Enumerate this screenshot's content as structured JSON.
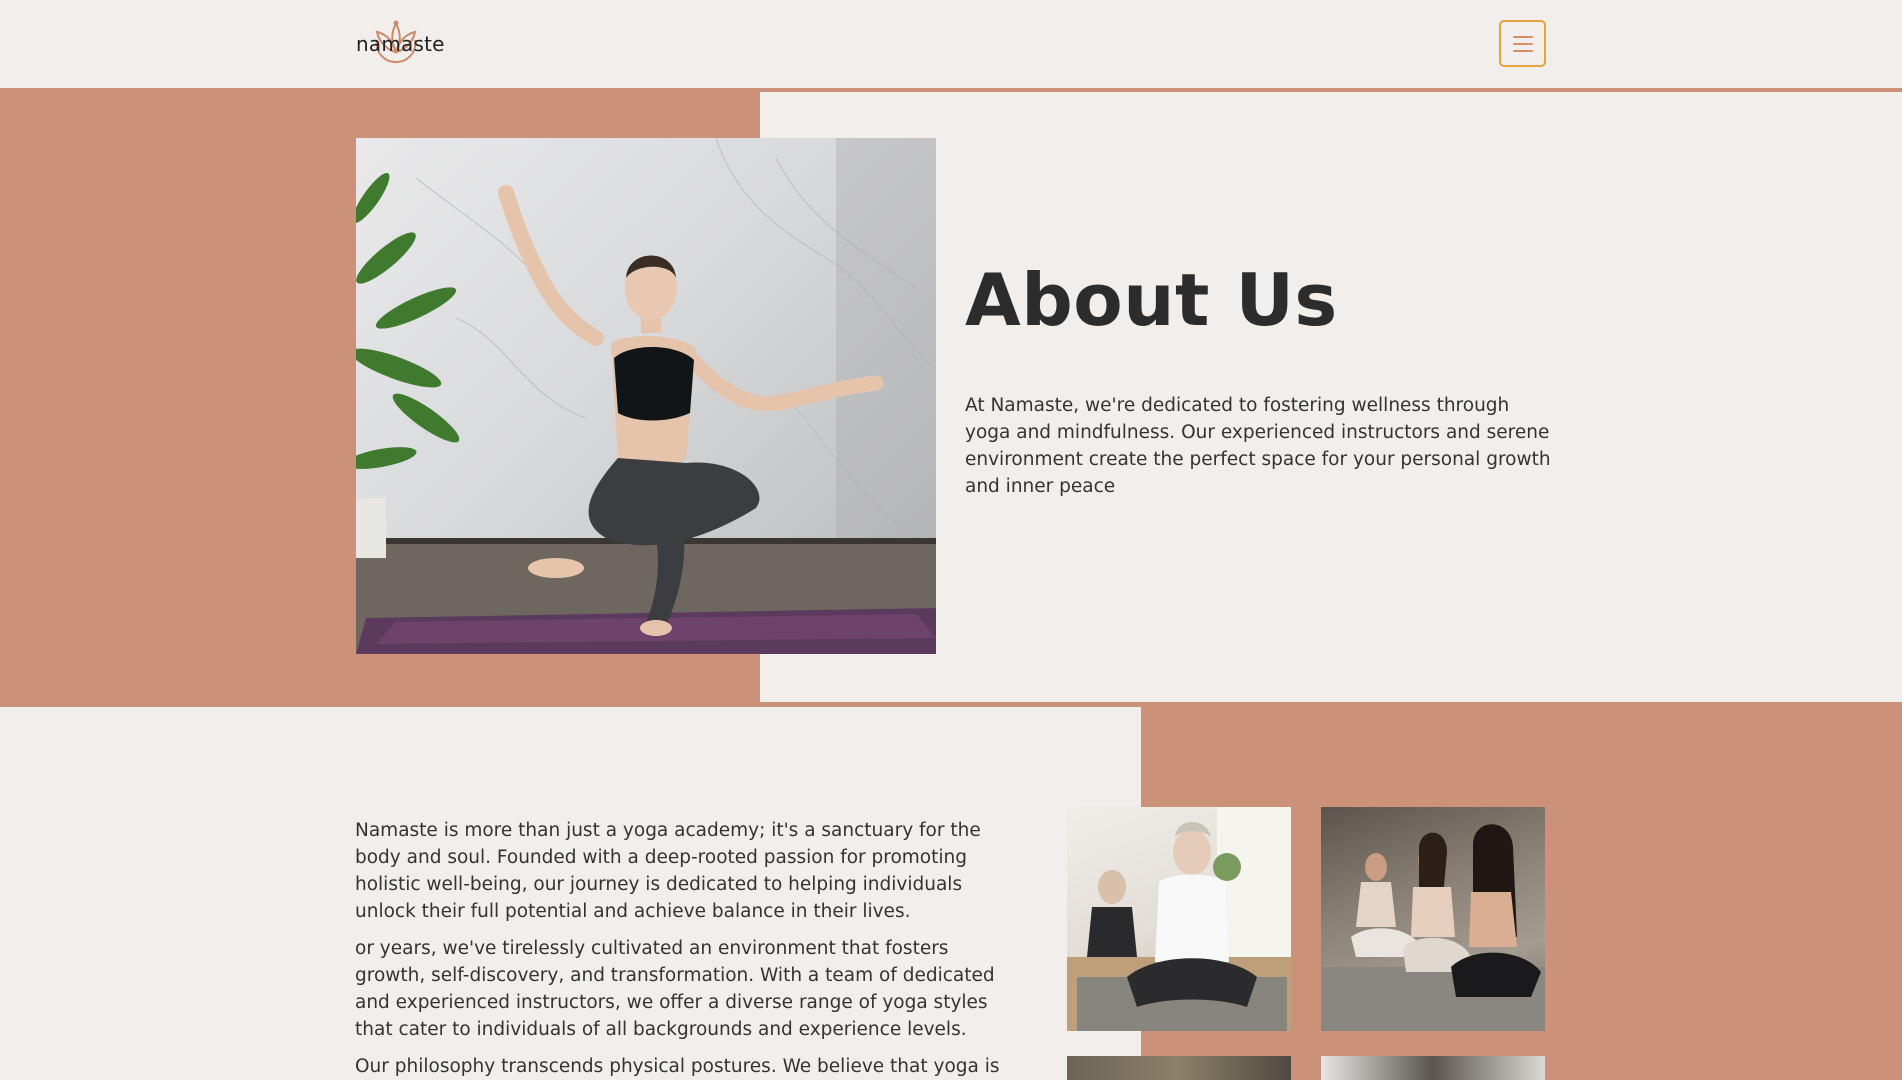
{
  "header": {
    "logo_text": "namaste",
    "menu_icon": "hamburger-menu-icon"
  },
  "hero": {
    "title": "About Us",
    "description": "At Namaste, we're dedicated to fostering wellness through yoga and mindfulness. Our experienced instructors and serene environment create the perfect space for your personal growth and inner peace"
  },
  "story": {
    "paragraphs": [
      "Namaste is more than just a yoga academy; it's a sanctuary for the body and soul. Founded with a deep-rooted passion for promoting holistic well-being, our journey is dedicated to helping individuals unlock their full potential and achieve balance in their lives.",
      "or years, we've tirelessly cultivated an environment that fosters growth, self-discovery, and transformation. With a team of dedicated and experienced instructors, we offer a diverse range of yoga styles that cater to individuals of all backgrounds and experience levels.",
      "Our philosophy transcends physical postures. We believe that yoga is a"
    ]
  },
  "colors": {
    "accent_band": "#cb9279",
    "background": "#f2eeeb",
    "menu_border": "#e6a23c",
    "text": "#2e2e2e"
  }
}
